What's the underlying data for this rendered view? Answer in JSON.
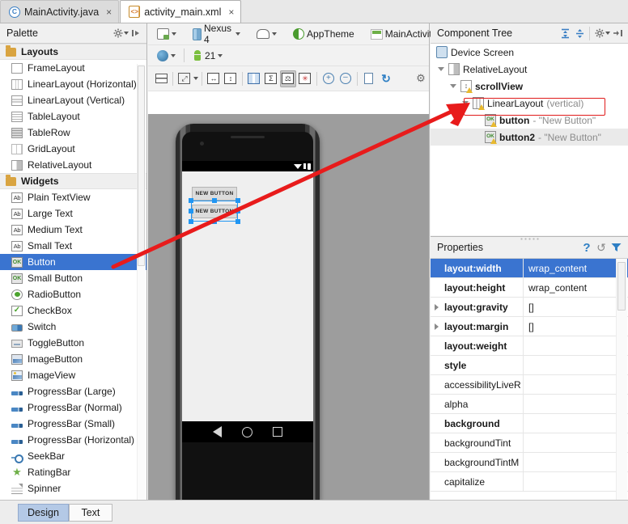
{
  "window": {
    "file_tabs": [
      {
        "label": "MainActivity.java",
        "icon": "java-class-icon",
        "close": "×",
        "active": false
      },
      {
        "label": "activity_main.xml",
        "icon": "xml-file-icon",
        "close": "×",
        "active": true
      }
    ]
  },
  "palette": {
    "title": "Palette",
    "header_icons": [
      "gear-icon",
      "collapse-panel-icon"
    ],
    "groups": [
      {
        "name": "Layouts",
        "items": [
          {
            "label": "FrameLayout",
            "icon": "frame-layout-icon"
          },
          {
            "label": "LinearLayout (Horizontal)",
            "icon": "linear-layout-horizontal-icon"
          },
          {
            "label": "LinearLayout (Vertical)",
            "icon": "linear-layout-vertical-icon"
          },
          {
            "label": "TableLayout",
            "icon": "table-layout-icon"
          },
          {
            "label": "TableRow",
            "icon": "table-row-icon"
          },
          {
            "label": "GridLayout",
            "icon": "grid-layout-icon"
          },
          {
            "label": "RelativeLayout",
            "icon": "relative-layout-icon"
          }
        ]
      },
      {
        "name": "Widgets",
        "items": [
          {
            "label": "Plain TextView",
            "icon": "text-ab-icon"
          },
          {
            "label": "Large Text",
            "icon": "text-ab-icon"
          },
          {
            "label": "Medium Text",
            "icon": "text-ab-icon"
          },
          {
            "label": "Small Text",
            "icon": "text-ab-icon"
          },
          {
            "label": "Button",
            "icon": "button-ok-icon",
            "selected": true
          },
          {
            "label": "Small Button",
            "icon": "button-ok-icon"
          },
          {
            "label": "RadioButton",
            "icon": "radio-button-icon"
          },
          {
            "label": "CheckBox",
            "icon": "checkbox-icon"
          },
          {
            "label": "Switch",
            "icon": "switch-icon"
          },
          {
            "label": "ToggleButton",
            "icon": "toggle-button-icon"
          },
          {
            "label": "ImageButton",
            "icon": "image-button-icon"
          },
          {
            "label": "ImageView",
            "icon": "image-view-icon"
          },
          {
            "label": "ProgressBar (Large)",
            "icon": "progress-bar-icon"
          },
          {
            "label": "ProgressBar (Normal)",
            "icon": "progress-bar-icon"
          },
          {
            "label": "ProgressBar (Small)",
            "icon": "progress-bar-icon"
          },
          {
            "label": "ProgressBar (Horizontal)",
            "icon": "progress-bar-icon"
          },
          {
            "label": "SeekBar",
            "icon": "seek-bar-icon"
          },
          {
            "label": "RatingBar",
            "icon": "rating-star-icon"
          },
          {
            "label": "Spinner",
            "icon": "spinner-icon"
          }
        ]
      }
    ]
  },
  "editor_toolbar": {
    "row1": [
      {
        "label": "",
        "icon": "device-select-icon",
        "dropdown": true
      },
      {
        "label": "Nexus 4",
        "icon": "nexus-device-icon",
        "dropdown": true
      },
      {
        "label": "",
        "icon": "orientation-icon",
        "dropdown": true
      },
      {
        "label": "AppTheme",
        "icon": "theme-icon",
        "dropdown": false
      },
      {
        "label": "MainActivity",
        "icon": "activity-icon",
        "dropdown": true
      }
    ],
    "row2": [
      {
        "label": "",
        "icon": "locale-globe-icon",
        "dropdown": true
      },
      {
        "label": "21",
        "icon": "android-api-icon",
        "dropdown": true
      }
    ],
    "row3": [
      {
        "icon": "render-rows-icon",
        "pressed": false
      },
      {
        "icon": "zoom-to-fit-icon",
        "pressed": false,
        "dropdown": true
      },
      {
        "icon": "distribute-horizontal-icon",
        "pressed": false
      },
      {
        "icon": "distribute-vertical-icon",
        "pressed": false
      },
      {
        "icon": "columns-icon",
        "pressed": false
      },
      {
        "icon": "sum-baseline-icon",
        "pressed": false
      },
      {
        "icon": "balance-gravity-icon",
        "pressed": true
      },
      {
        "icon": "clear-constraints-icon",
        "pressed": false
      },
      {
        "icon": "zoom-in-icon",
        "pressed": false
      },
      {
        "icon": "zoom-out-icon",
        "pressed": false
      },
      {
        "icon": "document-icon",
        "pressed": false
      },
      {
        "icon": "refresh-icon",
        "pressed": false
      },
      {
        "icon": "gear-icon",
        "pressed": false
      }
    ]
  },
  "preview": {
    "device_name": "Nexus 4",
    "status_icons": [
      "wifi-icon",
      "signal-icon",
      "battery-icon"
    ],
    "widgets": [
      {
        "label": "NEW BUTTON",
        "selected": false
      },
      {
        "label": "NEW BUTTON",
        "selected": true
      }
    ],
    "nav_buttons": [
      "back-icon",
      "home-icon",
      "recents-icon"
    ]
  },
  "component_tree": {
    "title": "Component Tree",
    "header_icons": [
      "expand-all-icon",
      "collapse-all-icon",
      "gear-icon",
      "collapse-panel-icon"
    ],
    "nodes": [
      {
        "label": "Device Screen",
        "sub": "",
        "icon": "device-screen-icon",
        "indent": 0,
        "twisty": false,
        "bold": false,
        "warn": false
      },
      {
        "label": "RelativeLayout",
        "sub": "",
        "icon": "relative-layout-icon",
        "indent": 1,
        "twisty": true,
        "bold": false,
        "warn": false
      },
      {
        "label": "scrollView",
        "sub": "",
        "icon": "scroll-view-icon",
        "indent": 2,
        "twisty": true,
        "bold": true,
        "warn": true
      },
      {
        "label": "LinearLayout",
        "sub": " (vertical)",
        "icon": "linear-layout-icon",
        "indent": 3,
        "twisty": true,
        "bold": false,
        "warn": true,
        "highlighted": true
      },
      {
        "label": "button",
        "sub": " - \"New Button\"",
        "icon": "button-ok-icon",
        "indent": 4,
        "twisty": false,
        "bold": true,
        "warn": true
      },
      {
        "label": "button2",
        "sub": " - \"New Button\"",
        "icon": "button-ok-icon",
        "indent": 4,
        "twisty": false,
        "bold": true,
        "warn": true,
        "row_highlight": true
      }
    ]
  },
  "properties": {
    "title": "Properties",
    "header_icons": [
      "help-icon",
      "reset-icon",
      "filter-icon"
    ],
    "columns": [
      "name",
      "value"
    ],
    "rows": [
      {
        "name": "layout:width",
        "value": "wrap_content",
        "bold": true,
        "expandable": false,
        "selected": true
      },
      {
        "name": "layout:height",
        "value": "wrap_content",
        "bold": true,
        "expandable": false,
        "selected": false
      },
      {
        "name": "layout:gravity",
        "value": "[]",
        "bold": true,
        "expandable": true,
        "selected": false
      },
      {
        "name": "layout:margin",
        "value": "[]",
        "bold": true,
        "expandable": true,
        "selected": false
      },
      {
        "name": "layout:weight",
        "value": "",
        "bold": true,
        "expandable": false,
        "selected": false
      },
      {
        "name": "style",
        "value": "",
        "bold": true,
        "expandable": false,
        "selected": false
      },
      {
        "name": "accessibilityLiveR",
        "value": "",
        "bold": false,
        "expandable": false,
        "selected": false
      },
      {
        "name": "alpha",
        "value": "",
        "bold": false,
        "expandable": false,
        "selected": false
      },
      {
        "name": "background",
        "value": "",
        "bold": true,
        "expandable": false,
        "selected": false
      },
      {
        "name": "backgroundTint",
        "value": "",
        "bold": false,
        "expandable": false,
        "selected": false
      },
      {
        "name": "backgroundTintM",
        "value": "",
        "bold": false,
        "expandable": false,
        "selected": false
      },
      {
        "name": "capitalize",
        "value": "",
        "bold": false,
        "expandable": false,
        "selected": false
      }
    ]
  },
  "bottom_tabs": [
    {
      "label": "Design",
      "active": true
    },
    {
      "label": "Text",
      "active": false
    }
  ],
  "annotation": {
    "type": "red-arrow",
    "color": "#e81b1b",
    "from_label": "Button",
    "to_label": "LinearLayout (vertical)"
  },
  "colors": {
    "selection_blue": "#3a74d0",
    "annotation_red": "#e81b1b",
    "canvas_gray": "#9d9d9d",
    "panel_bg": "#f0f0f0"
  }
}
